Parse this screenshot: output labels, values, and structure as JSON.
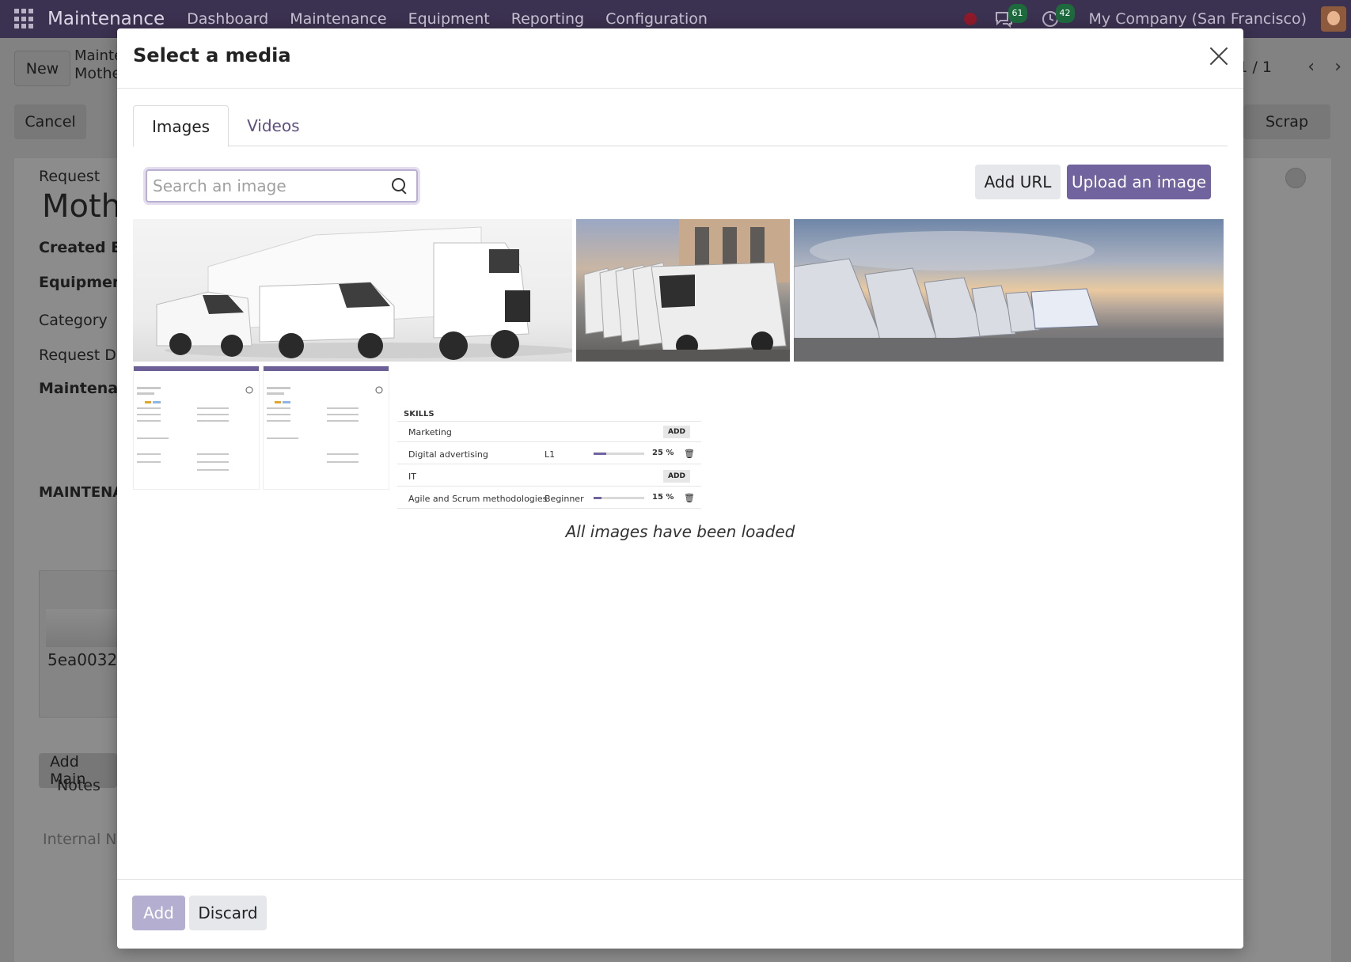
{
  "navbar": {
    "app_name": "Maintenance",
    "menu": [
      "Dashboard",
      "Maintenance",
      "Equipment",
      "Reporting",
      "Configuration"
    ],
    "messages_count": "61",
    "activities_count": "42",
    "company": "My Company (San Francisco)"
  },
  "background": {
    "new_button": "New",
    "breadcrumb_parent": "Mainte",
    "breadcrumb_current": "Mothe",
    "cancel_button": "Cancel",
    "scrap_button": "Scrap",
    "pager": "1 / 1",
    "request_label": "Request",
    "request_title": "Moth",
    "created_by_label": "Created By",
    "equipment_label": "Equipment",
    "category_label": "Category",
    "request_date_label": "Request Da",
    "maintenance_label": "Maintenan",
    "section_maintenance": "MAINTENA",
    "image_name": "5ea0032",
    "add_maintenance_button": "Add Main",
    "notes_tab": "Notes",
    "internal_notes_placeholder": "Internal No"
  },
  "modal": {
    "title": "Select a media",
    "tabs": [
      "Images",
      "Videos"
    ],
    "search_placeholder": "Search an image",
    "add_url_button": "Add URL",
    "upload_button": "Upload an image",
    "loaded_message": "All images have been loaded",
    "add_button": "Add",
    "discard_button": "Discard",
    "skills_card": {
      "header": "SKILLS",
      "add_label": "ADD",
      "groups": [
        {
          "name": "Marketing",
          "skill": "Digital advertising",
          "level": "L1",
          "progress_text": "25 %",
          "progress": 0.25
        },
        {
          "name": "IT",
          "skill": "Agile and Scrum methodologies",
          "level": "Beginner",
          "progress_text": "15 %",
          "progress": 0.15
        }
      ]
    }
  },
  "colors": {
    "navbar": "#3b3150",
    "primary": "#71639e",
    "primary_disabled": "#b4aed0",
    "secondary": "#e5e7ea"
  }
}
